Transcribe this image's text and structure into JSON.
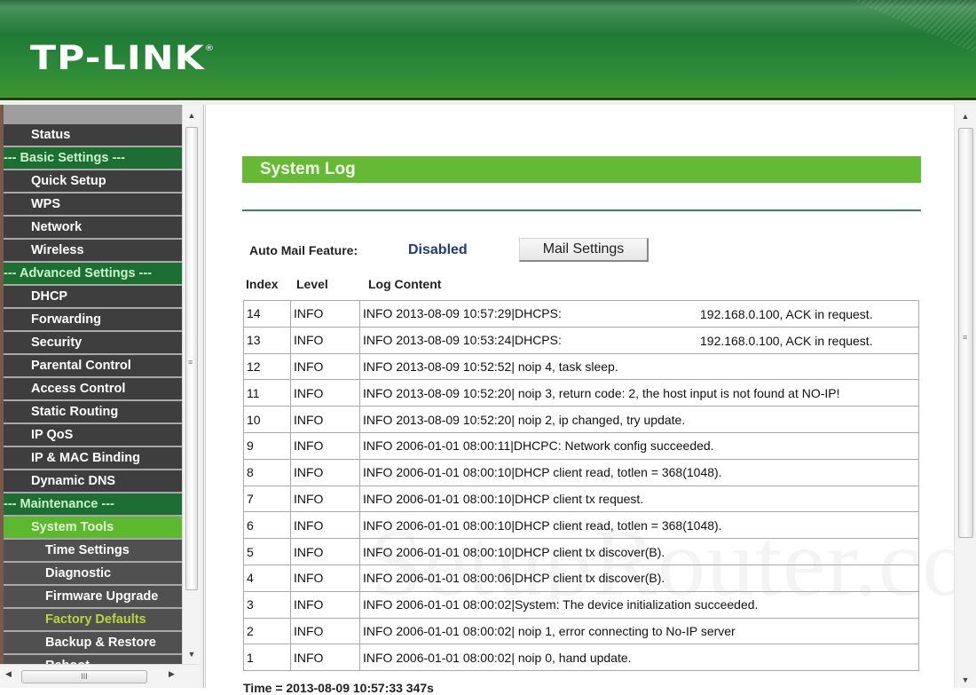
{
  "header": {
    "logo": "TP-LINK",
    "logo_mark": "®"
  },
  "sidebar": {
    "items": [
      {
        "label": "Status",
        "type": "item"
      },
      {
        "label": "--- Basic Settings ---",
        "type": "group"
      },
      {
        "label": "Quick Setup",
        "type": "item"
      },
      {
        "label": "WPS",
        "type": "item"
      },
      {
        "label": "Network",
        "type": "item"
      },
      {
        "label": "Wireless",
        "type": "item"
      },
      {
        "label": "--- Advanced Settings ---",
        "type": "group"
      },
      {
        "label": "DHCP",
        "type": "item"
      },
      {
        "label": "Forwarding",
        "type": "item"
      },
      {
        "label": "Security",
        "type": "item"
      },
      {
        "label": "Parental Control",
        "type": "item"
      },
      {
        "label": "Access Control",
        "type": "item"
      },
      {
        "label": "Static Routing",
        "type": "item"
      },
      {
        "label": "IP QoS",
        "type": "item"
      },
      {
        "label": "IP & MAC Binding",
        "type": "item"
      },
      {
        "label": "Dynamic DNS",
        "type": "item"
      },
      {
        "label": "--- Maintenance ---",
        "type": "group"
      },
      {
        "label": "System Tools",
        "type": "active"
      },
      {
        "label": "Time Settings",
        "type": "sub"
      },
      {
        "label": "Diagnostic",
        "type": "sub"
      },
      {
        "label": "Firmware Upgrade",
        "type": "sub"
      },
      {
        "label": "Factory Defaults",
        "type": "sub-highlight"
      },
      {
        "label": "Backup & Restore",
        "type": "sub"
      },
      {
        "label": "Reboot",
        "type": "sub"
      }
    ],
    "scroll_up_icon": "▲",
    "scroll_down_icon": "▼",
    "scroll_left_icon": "◀",
    "scroll_right_icon": "▶",
    "grip": "III"
  },
  "main": {
    "title": "System Log",
    "auto_mail_label": "Auto Mail Feature:",
    "auto_mail_value": "Disabled",
    "mail_settings_button": "Mail Settings",
    "columns": {
      "index": "Index",
      "level": "Level",
      "content": "Log Content"
    },
    "rows": [
      {
        "index": "14",
        "level": "INFO",
        "content": "INFO 2013-08-09 10:57:29|DHCPS:",
        "extra": "192.168.0.100, ACK in request."
      },
      {
        "index": "13",
        "level": "INFO",
        "content": "INFO 2013-08-09 10:53:24|DHCPS:",
        "extra": "192.168.0.100, ACK in request."
      },
      {
        "index": "12",
        "level": "INFO",
        "content": "INFO 2013-08-09 10:52:52| noip 4, task sleep.",
        "extra": ""
      },
      {
        "index": "11",
        "level": "INFO",
        "content": "INFO 2013-08-09 10:52:20| noip 3, return code: 2, the host input is not found at NO-IP!",
        "extra": ""
      },
      {
        "index": "10",
        "level": "INFO",
        "content": "INFO 2013-08-09 10:52:20| noip 2, ip changed, try update.",
        "extra": ""
      },
      {
        "index": "9",
        "level": "INFO",
        "content": "INFO 2006-01-01 08:00:11|DHCPC: Network config succeeded.",
        "extra": ""
      },
      {
        "index": "8",
        "level": "INFO",
        "content": "INFO 2006-01-01 08:00:10|DHCP client read, totlen = 368(1048).",
        "extra": ""
      },
      {
        "index": "7",
        "level": "INFO",
        "content": "INFO 2006-01-01 08:00:10|DHCP client tx request.",
        "extra": ""
      },
      {
        "index": "6",
        "level": "INFO",
        "content": "INFO 2006-01-01 08:00:10|DHCP client read, totlen = 368(1048).",
        "extra": ""
      },
      {
        "index": "5",
        "level": "INFO",
        "content": "INFO 2006-01-01 08:00:10|DHCP client tx discover(B).",
        "extra": ""
      },
      {
        "index": "4",
        "level": "INFO",
        "content": "INFO 2006-01-01 08:00:06|DHCP client tx discover(B).",
        "extra": ""
      },
      {
        "index": "3",
        "level": "INFO",
        "content": "INFO 2006-01-01 08:00:02|System: The device initialization succeeded.",
        "extra": ""
      },
      {
        "index": "2",
        "level": "INFO",
        "content": "INFO 2006-01-01 08:00:02| noip 1, error connecting to No-IP server",
        "extra": ""
      },
      {
        "index": "1",
        "level": "INFO",
        "content": "INFO 2006-01-01 08:00:02| noip 0, hand update.",
        "extra": ""
      }
    ],
    "time_line": "Time = 2013-08-09 10:57:33 347s",
    "watermark": "SetupRouter.com",
    "scroll_up_icon": "▲",
    "scroll_down_icon": "▼",
    "grip": "≡"
  },
  "colors": {
    "brand_green": "#1f7a36",
    "title_green": "#66b934",
    "group_green": "#1d6e35",
    "active_green": "#5cb82e",
    "disabled_blue": "#1f3c7a"
  }
}
